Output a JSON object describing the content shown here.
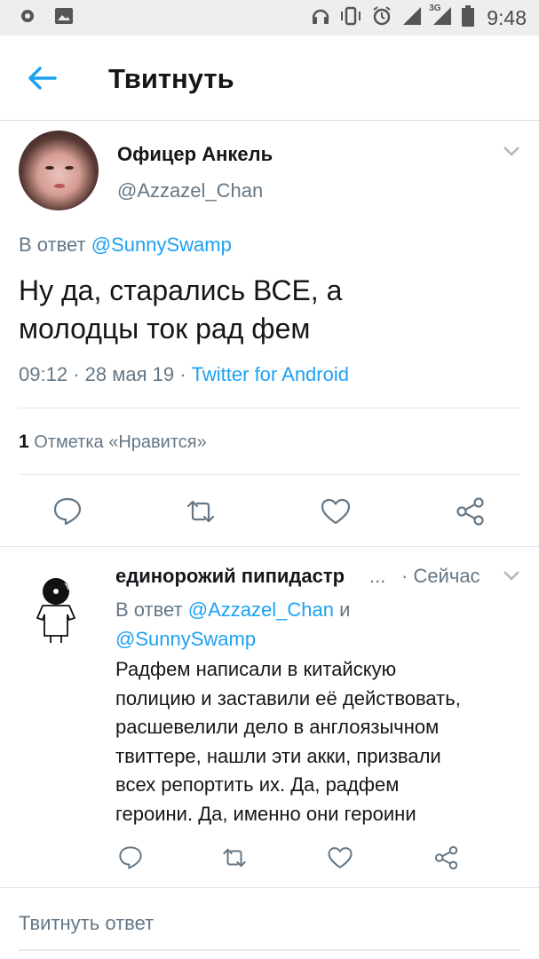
{
  "status_bar": {
    "time": "9:48",
    "network": "3G",
    "icons": [
      "settings-gear-icon",
      "image-icon",
      "headphones-icon",
      "vibrate-icon",
      "alarm-icon",
      "signal-icon",
      "battery-icon"
    ]
  },
  "app_bar": {
    "title": "Твитнуть",
    "back_icon": "arrow-left-icon"
  },
  "main_tweet": {
    "author_name": "Офицер Анкель",
    "author_handle": "@Azzazel_Chan",
    "reply_prefix": "В ответ",
    "reply_to": "@SunnySwamp",
    "text_line1": "Ну да, старались ВСЕ, а",
    "text_line2": "молодцы ток рад фем",
    "time": "09:12",
    "date": "28 мая 19",
    "separator": "·",
    "client": "Twitter for Android",
    "likes_count": "1",
    "likes_label": "Отметка «Нравится»"
  },
  "reply_tweet": {
    "author_name": "единорожий пипидастр",
    "ellipsis": "...",
    "time": "· Сейчас",
    "reply_prefix": "В ответ",
    "reply_to_1": "@Azzazel_Chan",
    "reply_joiner": "и",
    "reply_to_2": "@SunnySwamp",
    "text_lines": [
      "Радфем написали в китайскую",
      "полицию и заставили её действовать,",
      "расшевелили дело в англоязычном",
      "твиттере, нашли эти акки, призвали",
      "всех репортить их. Да, радфем",
      "героини. Да, именно они героини"
    ]
  },
  "compose": {
    "placeholder": "Твитнуть ответ"
  },
  "colors": {
    "accent": "#1da1f2",
    "secondary_text": "#657786",
    "primary_text": "#14171a",
    "divider": "#e1e8ed",
    "status_bar_bg": "#eeeeee"
  }
}
